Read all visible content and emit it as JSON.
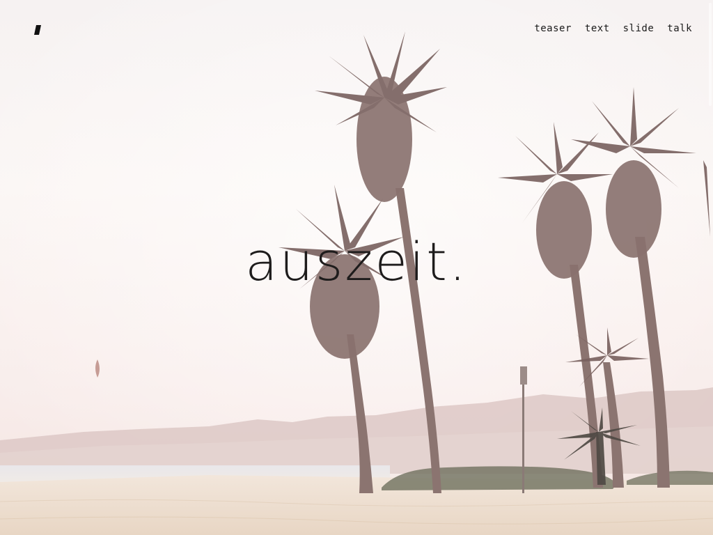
{
  "brand": {
    "logo_icon": "parallelogram-logo-icon",
    "logo_color": "#111111"
  },
  "nav": {
    "items": [
      {
        "label": "teaser"
      },
      {
        "label": "text"
      },
      {
        "label": "slide"
      },
      {
        "label": "talk"
      }
    ]
  },
  "hero": {
    "title": "auszeit."
  },
  "colors": {
    "sky": "#faf5f3",
    "sand": "#eadbcc",
    "mountains": "#d9c4c0",
    "palm": "#7a625f",
    "text": "#1e1c1c"
  }
}
